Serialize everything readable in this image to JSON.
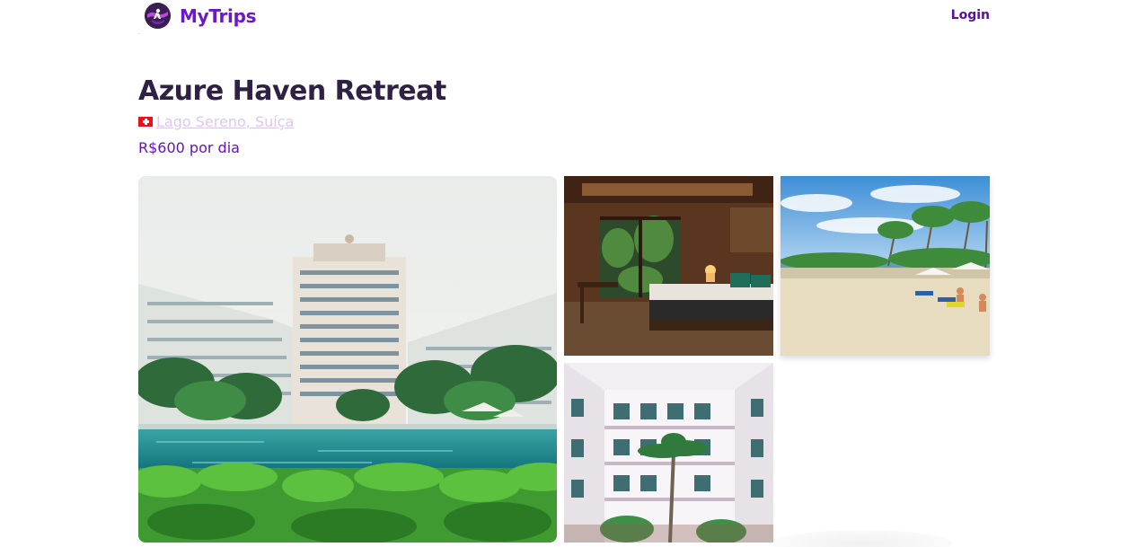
{
  "header": {
    "brand": "MyTrips",
    "brand_icon": "globe-traveler-icon",
    "login_label": "Login"
  },
  "listing": {
    "title": "Azure Haven Retreat",
    "flag_icon": "switzerland-flag-icon",
    "location": "Lago Sereno, Suíça",
    "price": "R$600 por dia"
  },
  "gallery": {
    "photos": [
      {
        "name": "resort-pool-photo",
        "subject": "resort-tower-with-pool-and-palms"
      },
      {
        "name": "bedroom-photo",
        "subject": "warm-lit-bedroom"
      },
      {
        "name": "beach-photo",
        "subject": "sandy-beach-with-umbrellas"
      },
      {
        "name": "courtyard-photo",
        "subject": "white-hotel-courtyard-with-palms"
      }
    ]
  },
  "colors": {
    "brand": "#6b18c9",
    "title": "#2e2143",
    "price": "#6a10b9",
    "location_link": "#dcc7ee",
    "login": "#5b0d98"
  }
}
